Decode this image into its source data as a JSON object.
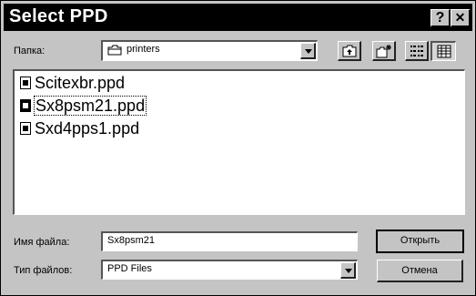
{
  "window": {
    "title": "Select PPD",
    "help_label": "?",
    "close_label": "✕"
  },
  "folder": {
    "label": "Папка:",
    "value": "printers",
    "toolbar": [
      "up-one-level-icon",
      "new-folder-icon",
      "list-view-icon",
      "details-view-icon"
    ]
  },
  "files": [
    {
      "name": "Scitexbr.ppd",
      "selected": false
    },
    {
      "name": "Sx8psm21.ppd",
      "selected": true
    },
    {
      "name": "Sxd4pps1.ppd",
      "selected": false
    }
  ],
  "filename": {
    "label": "Имя файла:",
    "value": "Sx8psm21"
  },
  "filetype": {
    "label": "Тип файлов:",
    "value": "PPD Files"
  },
  "buttons": {
    "open": "Открыть",
    "cancel": "Отмена"
  }
}
